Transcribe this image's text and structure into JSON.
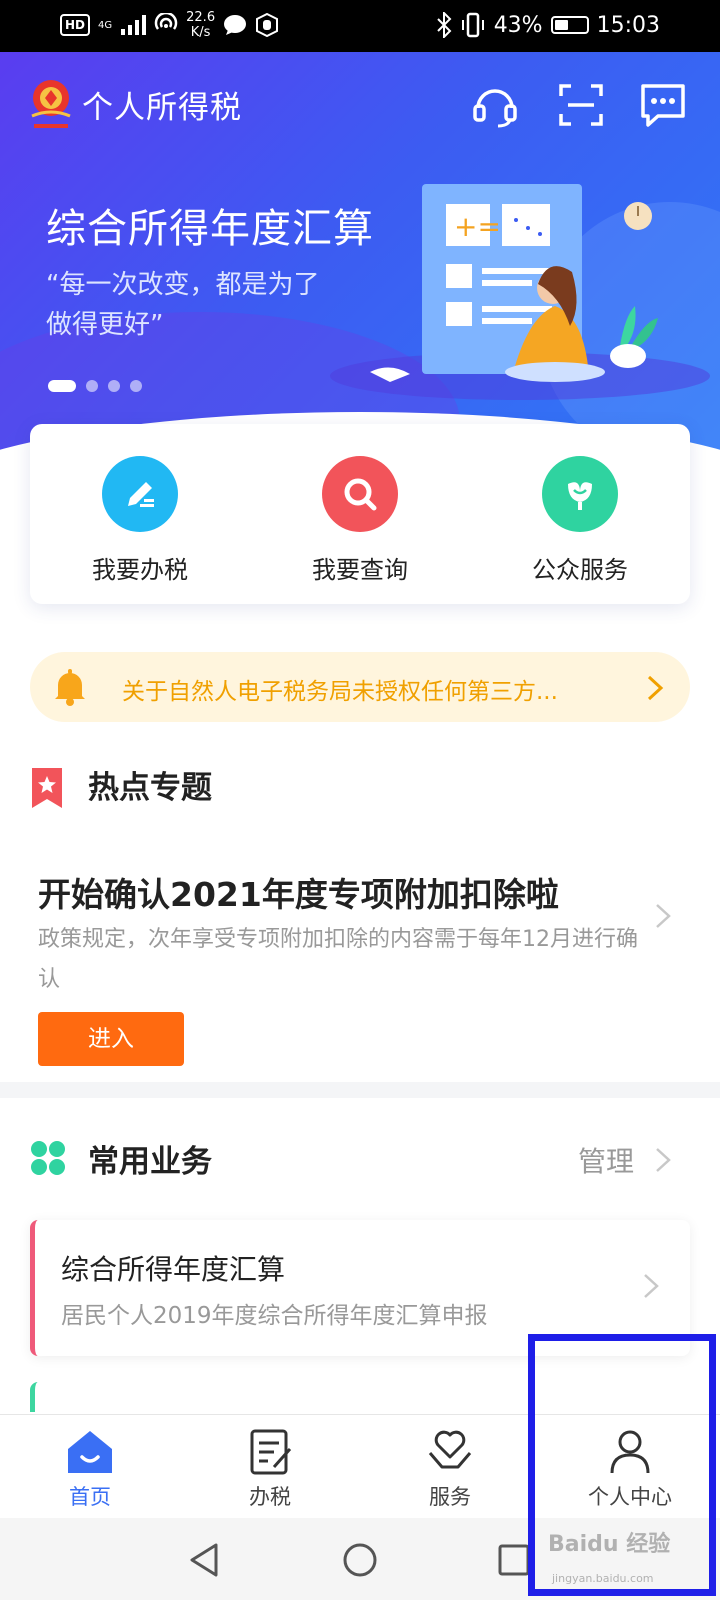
{
  "status_bar": {
    "hd": "HD",
    "network": "4G",
    "speed_value": "22.6",
    "speed_unit": "K/s",
    "battery": "43%",
    "battery_level": 0.43,
    "time": "15:03"
  },
  "header": {
    "title": "个人所得税",
    "icons": [
      "headset-icon",
      "scan-icon",
      "message-icon"
    ]
  },
  "banner": {
    "title": "综合所得年度汇算",
    "quote_line1": "“每一次改变，都是为了",
    "quote_line2": "做得更好”",
    "pages": 4,
    "active_page": 1
  },
  "quick_actions": [
    {
      "label": "我要办税",
      "icon": "pencil-icon",
      "color": "#21b8f3"
    },
    {
      "label": "我要查询",
      "icon": "search-icon",
      "color": "#f2545a"
    },
    {
      "label": "公众服务",
      "icon": "tulip-icon",
      "color": "#2fd3a0"
    }
  ],
  "notice": {
    "text": "关于自然人电子税务局未授权任何第三方..."
  },
  "hot_topics": {
    "section_title": "热点专题",
    "headline": "开始确认2021年度专项附加扣除啦",
    "description": "政策规定，次年享受专项附加扣除的内容需于每年12月进行确认",
    "button": "进入"
  },
  "common_business": {
    "section_title": "常用业务",
    "manage": "管理",
    "items": [
      {
        "title": "综合所得年度汇算",
        "subtitle": "居民个人2019年度综合所得年度汇算申报"
      }
    ]
  },
  "bottom_nav": [
    {
      "label": "首页",
      "icon": "home-icon",
      "active": true
    },
    {
      "label": "办税",
      "icon": "tax-form-icon",
      "active": false
    },
    {
      "label": "服务",
      "icon": "heart-hand-icon",
      "active": false
    },
    {
      "label": "个人中心",
      "icon": "person-icon",
      "active": false
    }
  ],
  "watermark": {
    "text": "Baidu 经验",
    "url": "jingyan.baidu.com"
  },
  "colors": {
    "accent": "#3a6ff4",
    "notice_text": "#f0a000",
    "enter_button": "#ff6a10",
    "highlight": "#1e1ee8"
  }
}
